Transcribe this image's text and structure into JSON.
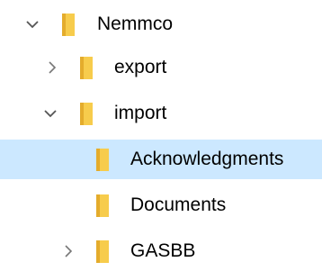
{
  "explorer_tree": {
    "items": [
      {
        "label": "Nemmco",
        "expanded": true,
        "selected": false,
        "icon": "folder-icon"
      },
      {
        "label": "export",
        "expanded": false,
        "selected": false,
        "icon": "folder-icon"
      },
      {
        "label": "import",
        "expanded": true,
        "selected": false,
        "icon": "folder-icon"
      },
      {
        "label": "Acknowledgments",
        "expanded": null,
        "selected": true,
        "icon": "folder-icon"
      },
      {
        "label": "Documents",
        "expanded": null,
        "selected": false,
        "icon": "folder-icon"
      },
      {
        "label": "GASBB",
        "expanded": false,
        "selected": false,
        "icon": "folder-icon"
      }
    ]
  },
  "colors": {
    "selection_background": "#cce8ff",
    "folder_yellow": "#f7cc4c",
    "folder_tab": "#e4ac2c",
    "chevron": "#555555",
    "text": "#000000"
  }
}
